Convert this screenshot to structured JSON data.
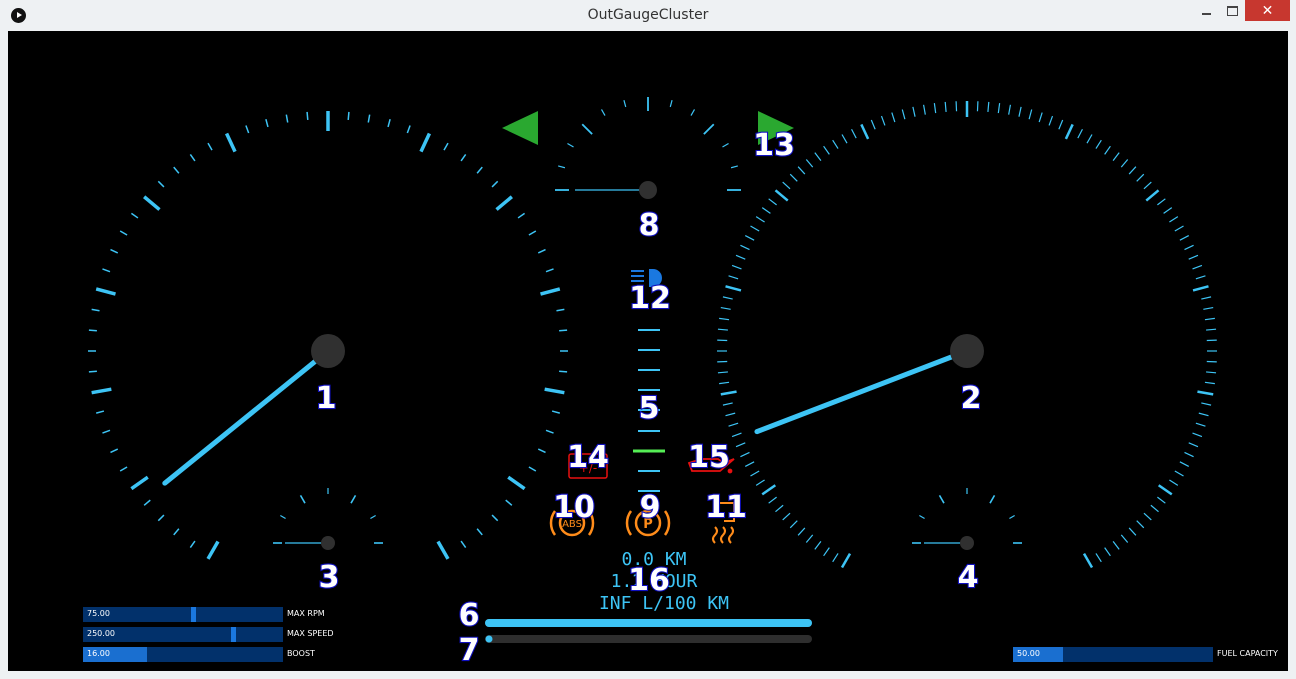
{
  "window": {
    "title": "OutGaugeCluster",
    "close_glyph": "✕"
  },
  "readouts": {
    "distance": "0.0 KM",
    "time": "1.2 HOUR",
    "consumption": "INF L/100 KM"
  },
  "gauges": {
    "rpm": {
      "fraction": 0.07
    },
    "speed": {
      "fraction": 0.13
    }
  },
  "labels": [
    "1",
    "2",
    "3",
    "4",
    "5",
    "6",
    "7",
    "8",
    "9",
    "10",
    "11",
    "12",
    "13",
    "14",
    "15",
    "16"
  ],
  "controls": {
    "max_rpm": {
      "value": "75.00",
      "label": "MAX RPM",
      "fraction": 0.55
    },
    "max_speed": {
      "value": "250.00",
      "label": "MAX SPEED",
      "fraction": 0.75
    },
    "boost": {
      "value": "16.00",
      "label": "BOOST",
      "fraction": 0.32
    },
    "fuel_capacity": {
      "value": "50.00",
      "label": "FUEL CAPACITY",
      "fraction": 0.25
    }
  },
  "indicators": {
    "abs": "ABS",
    "parking": "P"
  },
  "bars": {
    "progress_fraction": 1.0,
    "secondary_fraction": 0.0
  },
  "colors": {
    "cyan": "#3dc4f5",
    "green": "#2aa830",
    "orange": "#ff8c1a",
    "red": "#e81010",
    "lime": "#55ee55",
    "blue": "#1a78e0"
  }
}
